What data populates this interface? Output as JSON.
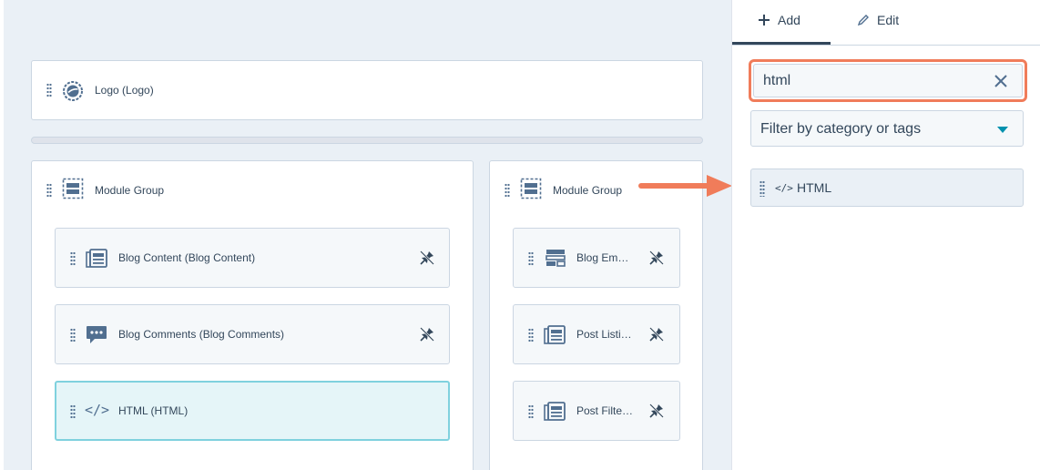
{
  "canvas": {
    "logo_module": {
      "label": "Logo (Logo)",
      "icon": "logo-icon"
    },
    "group_left": {
      "label": "Module Group",
      "modules": [
        {
          "label": "Blog Content (Blog Content)",
          "icon": "blog-content-icon"
        },
        {
          "label": "Blog Comments (Blog Comments)",
          "icon": "comments-icon"
        },
        {
          "label": "HTML (HTML)",
          "icon": "code-icon",
          "selected": true
        }
      ]
    },
    "group_right": {
      "label": "Module Group",
      "modules": [
        {
          "label": "Blog Em…",
          "icon": "blog-email-icon"
        },
        {
          "label": "Post Listi…",
          "icon": "blog-content-icon"
        },
        {
          "label": "Post Filte…",
          "icon": "blog-content-icon"
        }
      ]
    }
  },
  "sidebar": {
    "tabs": [
      {
        "label": "Add",
        "icon": "plus-icon",
        "active": true
      },
      {
        "label": "Edit",
        "icon": "pencil-icon",
        "active": false
      }
    ],
    "search": {
      "value": "html",
      "placeholder": ""
    },
    "filter": {
      "label": "Filter by category or tags"
    },
    "results": [
      {
        "label": "HTML",
        "code": "</>"
      }
    ]
  },
  "colors": {
    "accent_orange": "#f07c5a",
    "teal": "#0091ae",
    "selected_border": "#7fd1de",
    "text": "#33475b"
  }
}
